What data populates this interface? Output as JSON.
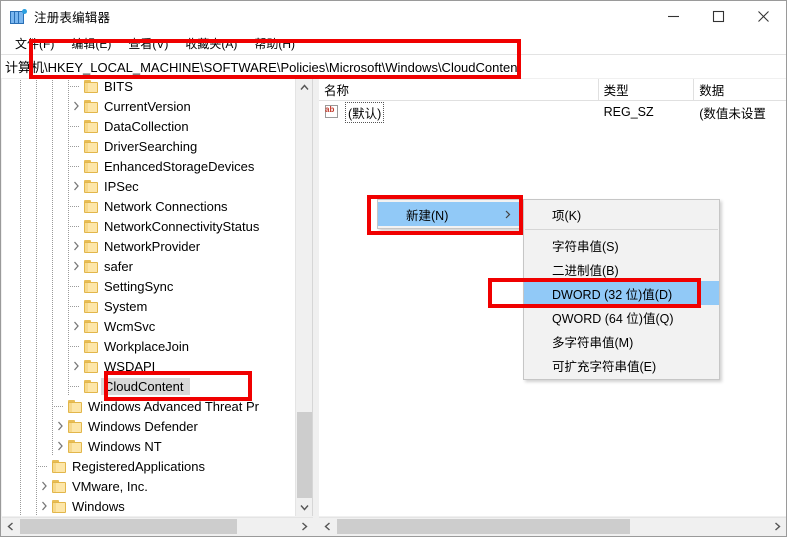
{
  "window": {
    "title": "注册表编辑器",
    "icon": "registry-editor-icon",
    "minimize_label": "—",
    "maximize_label": "□",
    "close_label": "✕"
  },
  "menubar": {
    "items": [
      {
        "label": "文件(F)",
        "name": "menu-file"
      },
      {
        "label": "编辑(E)",
        "name": "menu-edit"
      },
      {
        "label": "查看(V)",
        "name": "menu-view"
      },
      {
        "label": "收藏夹(A)",
        "name": "menu-favorites"
      },
      {
        "label": "帮助(H)",
        "name": "menu-help"
      }
    ]
  },
  "address": {
    "path": "计算机\\HKEY_LOCAL_MACHINE\\SOFTWARE\\Policies\\Microsoft\\Windows\\CloudContent"
  },
  "tree": {
    "items": [
      {
        "label": "BITS",
        "indent": 4,
        "expandable": false,
        "selected": false
      },
      {
        "label": "CurrentVersion",
        "indent": 4,
        "expandable": true,
        "selected": false
      },
      {
        "label": "DataCollection",
        "indent": 4,
        "expandable": false,
        "selected": false
      },
      {
        "label": "DriverSearching",
        "indent": 4,
        "expandable": false,
        "selected": false
      },
      {
        "label": "EnhancedStorageDevices",
        "indent": 4,
        "expandable": false,
        "selected": false
      },
      {
        "label": "IPSec",
        "indent": 4,
        "expandable": true,
        "selected": false
      },
      {
        "label": "Network Connections",
        "indent": 4,
        "expandable": false,
        "selected": false
      },
      {
        "label": "NetworkConnectivityStatus",
        "indent": 4,
        "expandable": false,
        "selected": false
      },
      {
        "label": "NetworkProvider",
        "indent": 4,
        "expandable": true,
        "selected": false
      },
      {
        "label": "safer",
        "indent": 4,
        "expandable": true,
        "selected": false
      },
      {
        "label": "SettingSync",
        "indent": 4,
        "expandable": false,
        "selected": false
      },
      {
        "label": "System",
        "indent": 4,
        "expandable": false,
        "selected": false
      },
      {
        "label": "WcmSvc",
        "indent": 4,
        "expandable": true,
        "selected": false
      },
      {
        "label": "WorkplaceJoin",
        "indent": 4,
        "expandable": false,
        "selected": false
      },
      {
        "label": "WSDAPI",
        "indent": 4,
        "expandable": true,
        "selected": false
      },
      {
        "label": "CloudContent",
        "indent": 4,
        "expandable": false,
        "selected": true
      },
      {
        "label": "Windows Advanced Threat Pr",
        "indent": 3,
        "expandable": false,
        "selected": false
      },
      {
        "label": "Windows Defender",
        "indent": 3,
        "expandable": true,
        "selected": false
      },
      {
        "label": "Windows NT",
        "indent": 3,
        "expandable": true,
        "selected": false
      },
      {
        "label": "RegisteredApplications",
        "indent": 2,
        "expandable": false,
        "selected": false
      },
      {
        "label": "VMware, Inc.",
        "indent": 2,
        "expandable": true,
        "selected": false
      },
      {
        "label": "Windows",
        "indent": 2,
        "expandable": true,
        "selected": false
      }
    ]
  },
  "list": {
    "columns": [
      "名称",
      "类型",
      "数据"
    ],
    "rows": [
      {
        "name": "(默认)",
        "type": "REG_SZ",
        "data": "(数值未设置",
        "icon": "ab-string-icon"
      }
    ]
  },
  "context_menu": {
    "parent": {
      "items": [
        {
          "label": "新建(N)",
          "highlighted": true,
          "submenu_arrow": "›"
        }
      ]
    },
    "submenu": {
      "items": [
        {
          "label": "项(K)",
          "highlighted": false,
          "separator_after": true
        },
        {
          "label": "字符串值(S)",
          "highlighted": false,
          "separator_after": false
        },
        {
          "label": "二进制值(B)",
          "highlighted": false,
          "separator_after": false
        },
        {
          "label": "DWORD (32 位)值(D)",
          "highlighted": true,
          "separator_after": false
        },
        {
          "label": "QWORD (64 位)值(Q)",
          "highlighted": false,
          "separator_after": false
        },
        {
          "label": "多字符串值(M)",
          "highlighted": false,
          "separator_after": false
        },
        {
          "label": "可扩充字符串值(E)",
          "highlighted": false,
          "separator_after": false
        }
      ]
    }
  },
  "annotations": {
    "boxes": [
      {
        "name": "address-bar-highlight",
        "color": "#f00000"
      },
      {
        "name": "cloudcontent-key-highlight",
        "color": "#f00000"
      },
      {
        "name": "new-menu-highlight",
        "color": "#f00000"
      },
      {
        "name": "dword-menu-highlight",
        "color": "#f00000"
      }
    ]
  },
  "colors": {
    "highlight_blue": "#91c9f7",
    "selection_gray": "#d9d9d9",
    "annotation_red": "#f00000",
    "folder_yellow": "#fde6a8"
  }
}
